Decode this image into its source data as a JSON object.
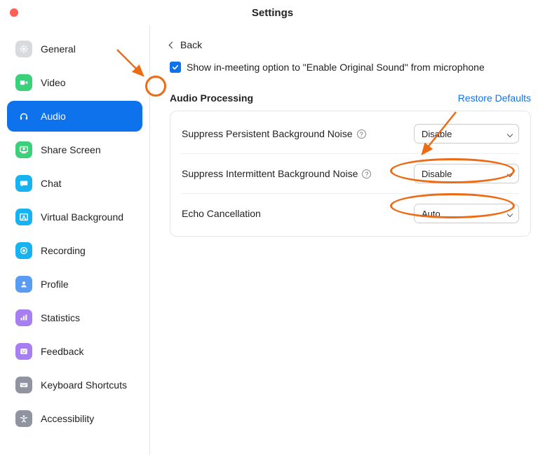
{
  "window": {
    "title": "Settings"
  },
  "sidebar": {
    "items": [
      {
        "key": "general",
        "label": "General",
        "icon": "gear-icon",
        "bg": "#d9dadd",
        "fg": "#fff"
      },
      {
        "key": "video",
        "label": "Video",
        "icon": "video-icon",
        "bg": "#3ad17a",
        "fg": "#fff"
      },
      {
        "key": "audio",
        "label": "Audio",
        "icon": "headphones-icon",
        "bg": "transparent",
        "fg": "#fff",
        "active": true
      },
      {
        "key": "share-screen",
        "label": "Share Screen",
        "icon": "share-screen-icon",
        "bg": "#3ad17a",
        "fg": "#fff"
      },
      {
        "key": "chat",
        "label": "Chat",
        "icon": "chat-icon",
        "bg": "#17b3f0",
        "fg": "#fff"
      },
      {
        "key": "virtual-background",
        "label": "Virtual Background",
        "icon": "virtual-bg-icon",
        "bg": "#17b3f0",
        "fg": "#fff"
      },
      {
        "key": "recording",
        "label": "Recording",
        "icon": "record-icon",
        "bg": "#17b3f0",
        "fg": "#fff"
      },
      {
        "key": "profile",
        "label": "Profile",
        "icon": "person-icon",
        "bg": "#5b9cf3",
        "fg": "#fff"
      },
      {
        "key": "statistics",
        "label": "Statistics",
        "icon": "stats-icon",
        "bg": "#a77ff0",
        "fg": "#fff"
      },
      {
        "key": "feedback",
        "label": "Feedback",
        "icon": "feedback-icon",
        "bg": "#a77ff0",
        "fg": "#fff"
      },
      {
        "key": "keyboard-shortcuts",
        "label": "Keyboard Shortcuts",
        "icon": "keyboard-icon",
        "bg": "#8f94a0",
        "fg": "#fff"
      },
      {
        "key": "accessibility",
        "label": "Accessibility",
        "icon": "accessibility-icon",
        "bg": "#8f94a0",
        "fg": "#fff"
      }
    ]
  },
  "content": {
    "back_label": "Back",
    "original_sound": {
      "checked": true,
      "label": "Show in-meeting option to \"Enable Original Sound\" from microphone"
    },
    "section_title": "Audio Processing",
    "restore_label": "Restore Defaults",
    "rows": [
      {
        "key": "suppress-persistent",
        "label": "Suppress Persistent Background Noise",
        "has_help": true,
        "value": "Disable"
      },
      {
        "key": "suppress-intermittent",
        "label": "Suppress Intermittent Background Noise",
        "has_help": true,
        "value": "Disable"
      },
      {
        "key": "echo-cancellation",
        "label": "Echo Cancellation",
        "has_help": false,
        "value": "Auto"
      }
    ]
  },
  "colors": {
    "accent": "#0e72ed",
    "annotation": "#ec6b14"
  }
}
